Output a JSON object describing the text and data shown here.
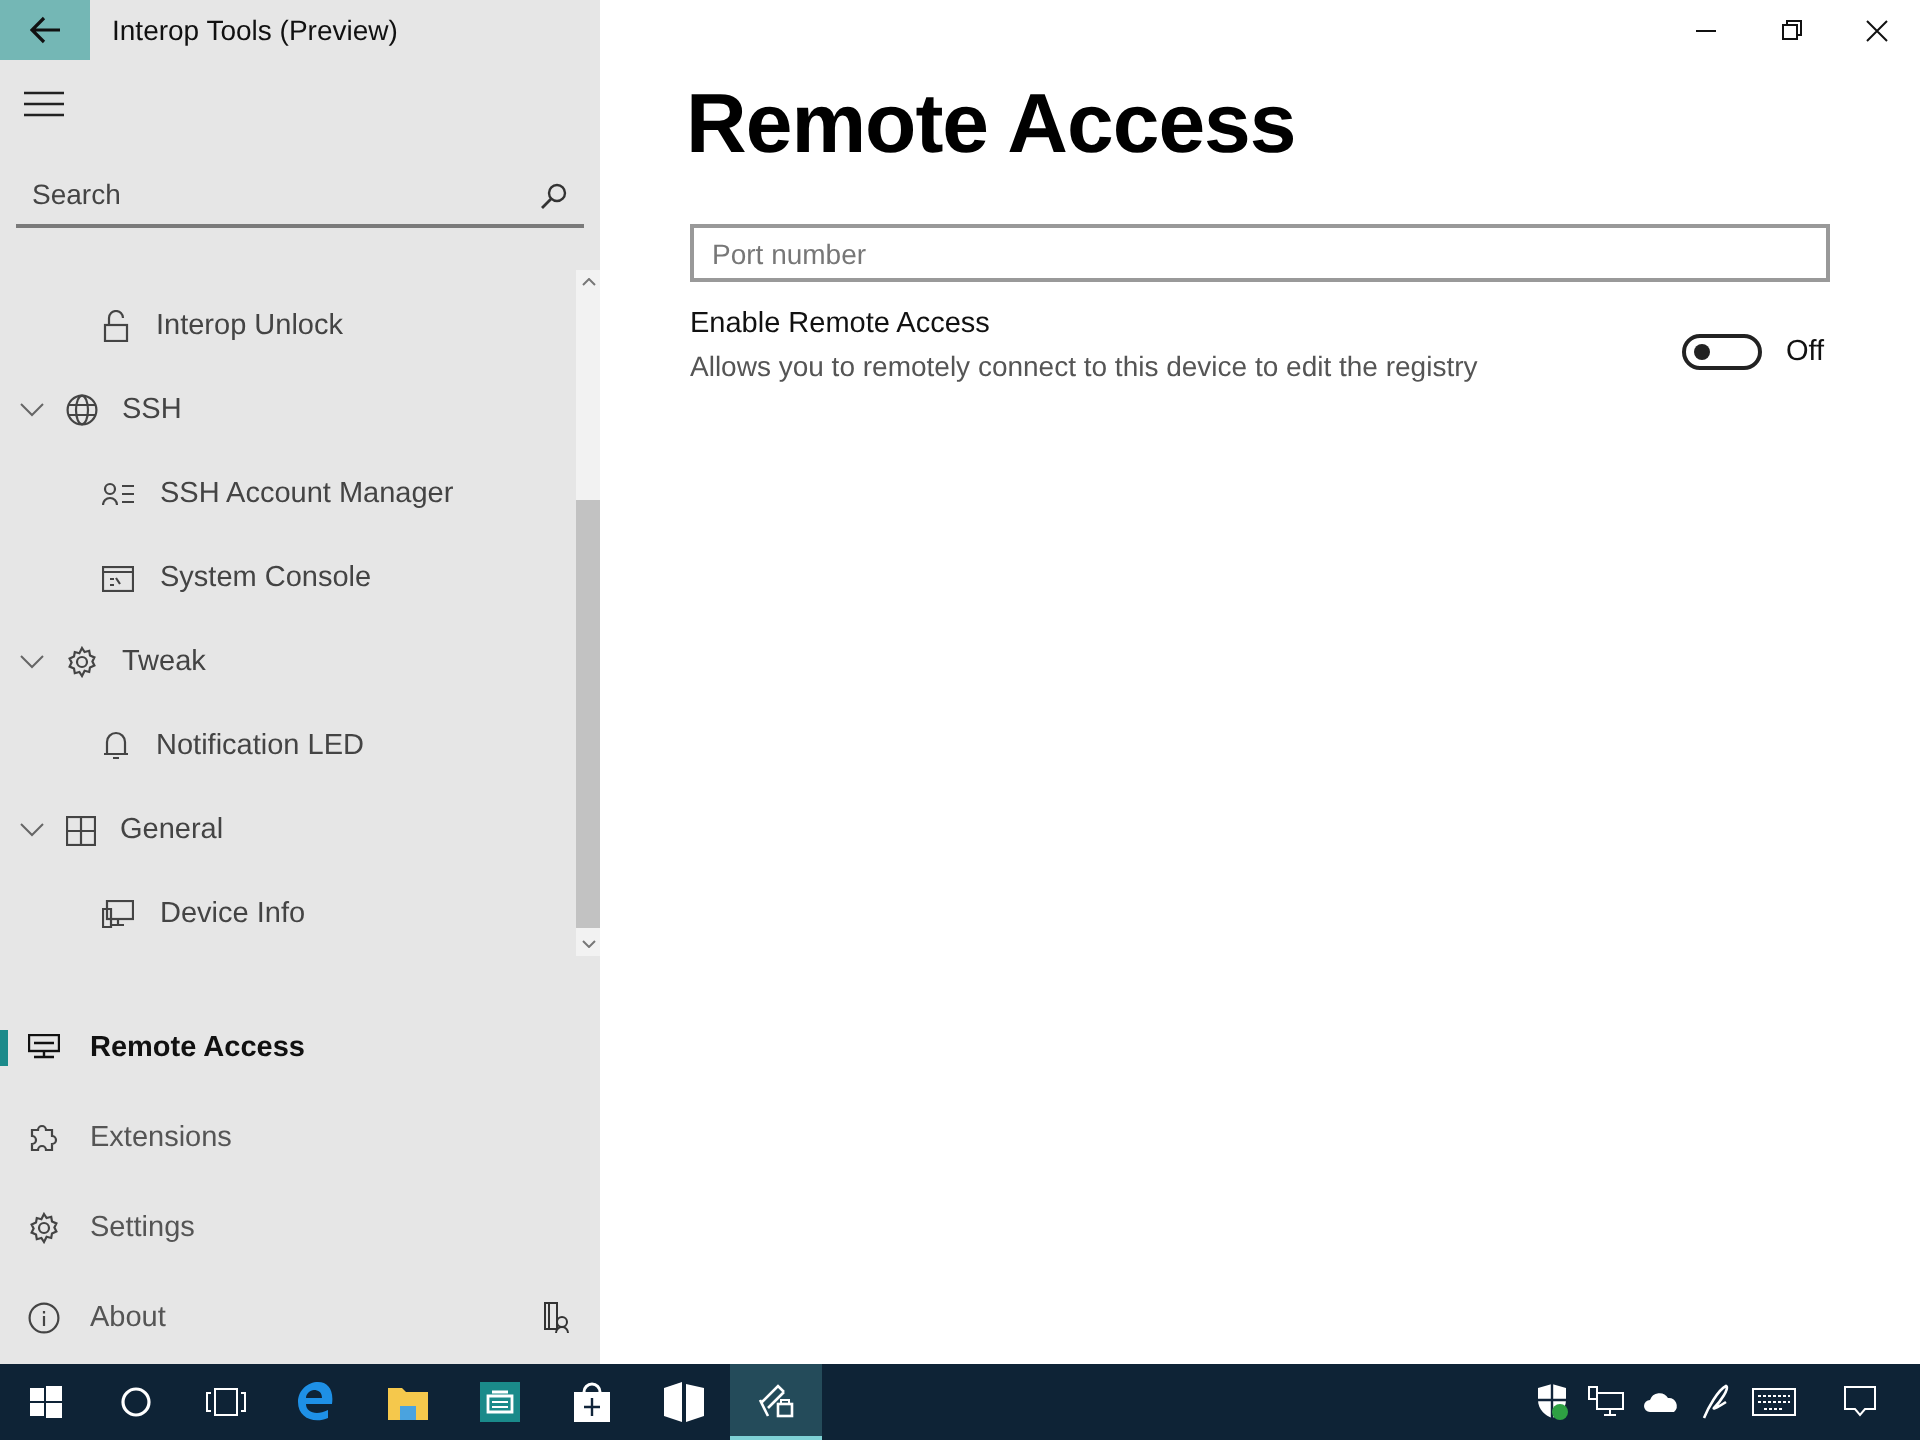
{
  "window": {
    "title": "Interop Tools (Preview)"
  },
  "search": {
    "placeholder": "Search"
  },
  "tree": [
    {
      "children": [
        {
          "label": "Interop Unlock"
        }
      ]
    },
    {
      "label": "SSH",
      "expanded": true,
      "children": [
        {
          "label": "SSH Account Manager"
        },
        {
          "label": "System Console"
        }
      ]
    },
    {
      "label": "Tweak",
      "expanded": true,
      "children": [
        {
          "label": "Notification LED"
        }
      ]
    },
    {
      "label": "General",
      "expanded": true,
      "children": [
        {
          "label": "Device Info"
        }
      ]
    }
  ],
  "nav": [
    {
      "label": "Remote Access",
      "selected": true
    },
    {
      "label": "Extensions",
      "selected": false
    },
    {
      "label": "Settings",
      "selected": false
    },
    {
      "label": "About",
      "selected": false
    }
  ],
  "page": {
    "title": "Remote Access",
    "port_field": {
      "placeholder": "Port number"
    },
    "setting": {
      "label": "Enable Remote Access",
      "description": "Allows you to remotely connect to this device to edit the registry",
      "on": false,
      "state_text": "Off"
    }
  },
  "taskbar": {
    "apps": [
      {
        "selected": false
      },
      {
        "selected": false
      },
      {
        "selected": false
      },
      {
        "selected": false
      },
      {
        "selected": false
      },
      {
        "selected": true
      }
    ]
  }
}
